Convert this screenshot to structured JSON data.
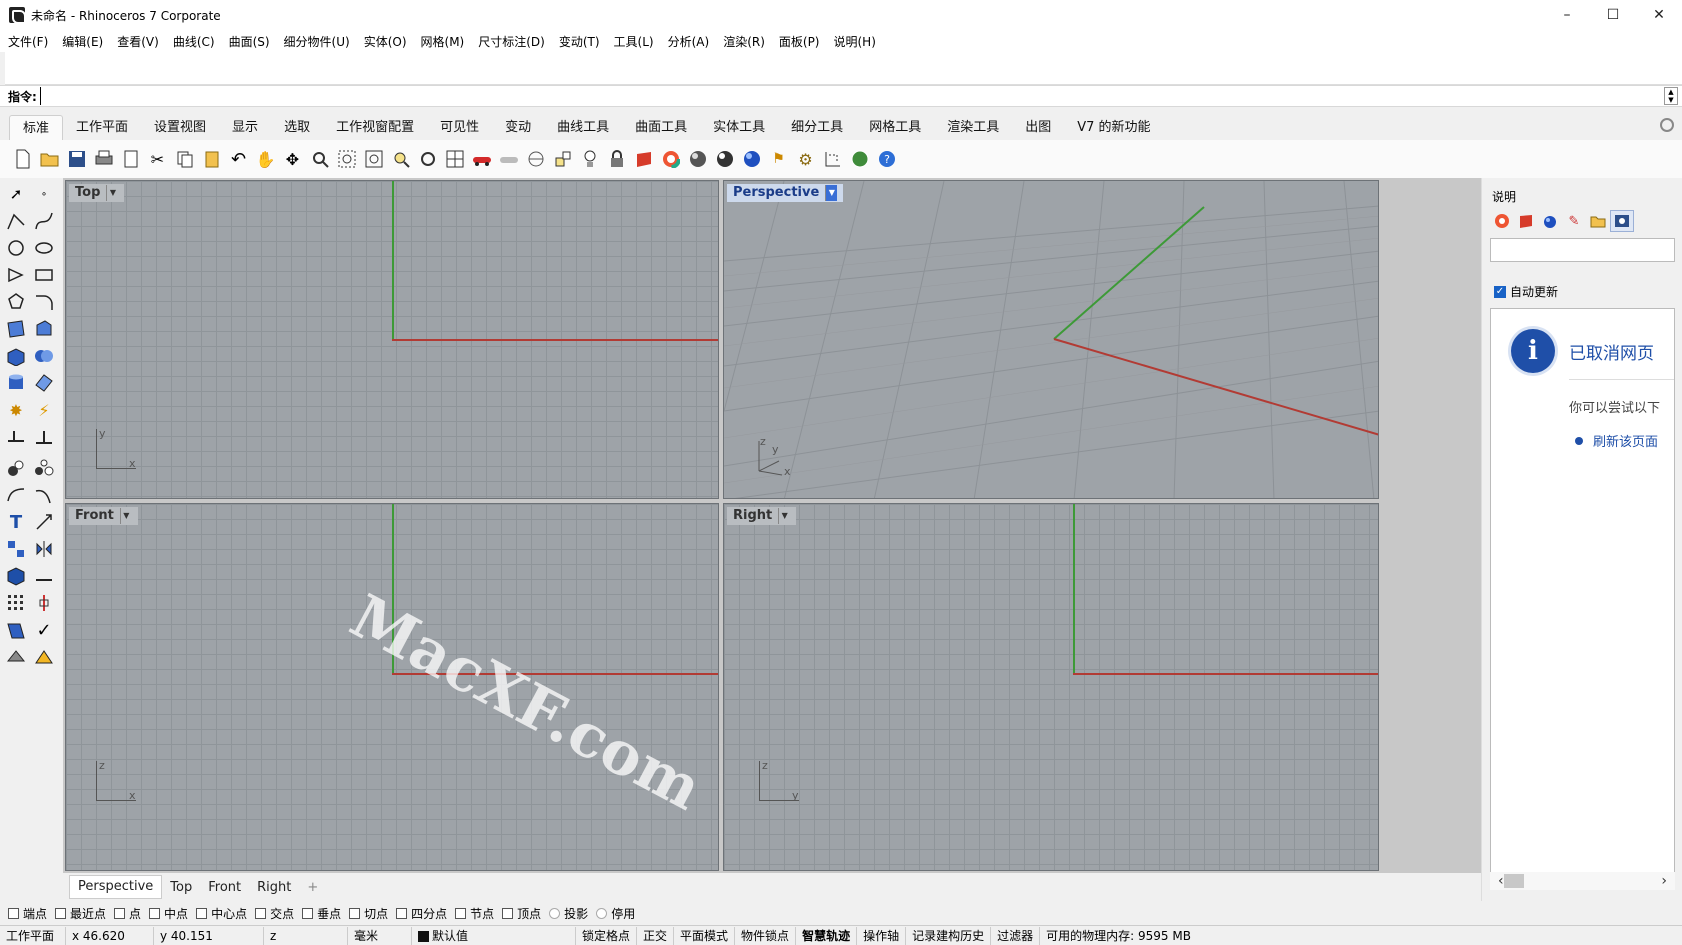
{
  "window": {
    "title": "未命名 - Rhinoceros 7 Corporate",
    "minimize": "–",
    "maximize": "☐",
    "close": "✕"
  },
  "menu": [
    "文件(F)",
    "编辑(E)",
    "查看(V)",
    "曲线(C)",
    "曲面(S)",
    "细分物件(U)",
    "实体(O)",
    "网格(M)",
    "尺寸标注(D)",
    "变动(T)",
    "工具(L)",
    "分析(A)",
    "渲染(R)",
    "面板(P)",
    "说明(H)"
  ],
  "command": {
    "label": "指令:",
    "value": ""
  },
  "tabs": [
    "标准",
    "工作平面",
    "设置视图",
    "显示",
    "选取",
    "工作视窗配置",
    "可见性",
    "变动",
    "曲线工具",
    "曲面工具",
    "实体工具",
    "细分工具",
    "网格工具",
    "渲染工具",
    "出图",
    "V7 的新功能"
  ],
  "viewports": {
    "top": {
      "label": "Top",
      "ax1": "y",
      "ax2": "x"
    },
    "perspective": {
      "label": "Perspective",
      "ax1": "z",
      "ax2": "y",
      "ax3": "x"
    },
    "front": {
      "label": "Front",
      "ax1": "z",
      "ax2": "x"
    },
    "right": {
      "label": "Right",
      "ax1": "z",
      "ax2": "y"
    }
  },
  "viewport_tabs": [
    "Perspective",
    "Top",
    "Front",
    "Right",
    "+"
  ],
  "right_panel": {
    "title": "说明",
    "auto_update": "自动更新",
    "web_title": "已取消网页",
    "web_text": "你可以尝试以下",
    "web_link": "刷新该页面"
  },
  "osnaps": [
    {
      "label": "端点",
      "checked": false
    },
    {
      "label": "最近点",
      "checked": false
    },
    {
      "label": "点",
      "checked": false
    },
    {
      "label": "中点",
      "checked": false
    },
    {
      "label": "中心点",
      "checked": false
    },
    {
      "label": "交点",
      "checked": false
    },
    {
      "label": "垂点",
      "checked": false
    },
    {
      "label": "切点",
      "checked": false
    },
    {
      "label": "四分点",
      "checked": false
    },
    {
      "label": "节点",
      "checked": false
    },
    {
      "label": "顶点",
      "checked": false
    },
    {
      "label": "投影",
      "checked": false
    },
    {
      "label": "停用",
      "checked": false
    }
  ],
  "status": {
    "cplane": "工作平面",
    "x": "x 46.620",
    "y": "y 40.151",
    "z": "z",
    "units": "毫米",
    "layer": "默认值",
    "grid_snap": "锁定格点",
    "ortho": "正交",
    "planar": "平面模式",
    "osnap": "物件锁点",
    "smarttrack": "智慧轨迹",
    "gumball": "操作轴",
    "history": "记录建构历史",
    "filter": "过滤器",
    "memory": "可用的物理内存: 9595 MB"
  },
  "watermark": "MacXF.com",
  "colors": {
    "x_axis": "#b23b34",
    "y_axis": "#3d9a37",
    "viewport_bg": "#9ea3a8",
    "accent": "#1f4fa8"
  }
}
